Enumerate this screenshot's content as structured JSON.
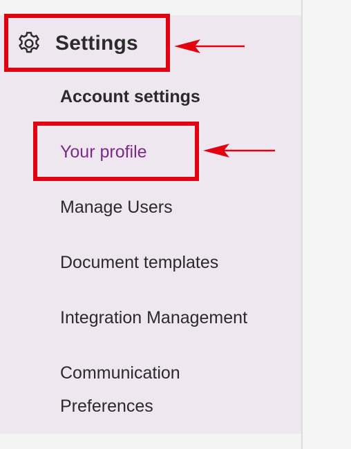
{
  "sidebar": {
    "header": {
      "icon": "gear-icon",
      "label": "Settings"
    },
    "items": [
      {
        "label": "Account settings",
        "style": "section-heading"
      },
      {
        "label": "Your profile",
        "state": "active"
      },
      {
        "label": "Manage Users"
      },
      {
        "label": "Document templates"
      },
      {
        "label": "Integration Management"
      },
      {
        "label": "Communication Preferences"
      }
    ]
  },
  "colors": {
    "sidebar_bg": "#efe7ef",
    "active_item": "#7a2a8a",
    "annotation": "#e3000f",
    "text": "#2a2a2a"
  }
}
